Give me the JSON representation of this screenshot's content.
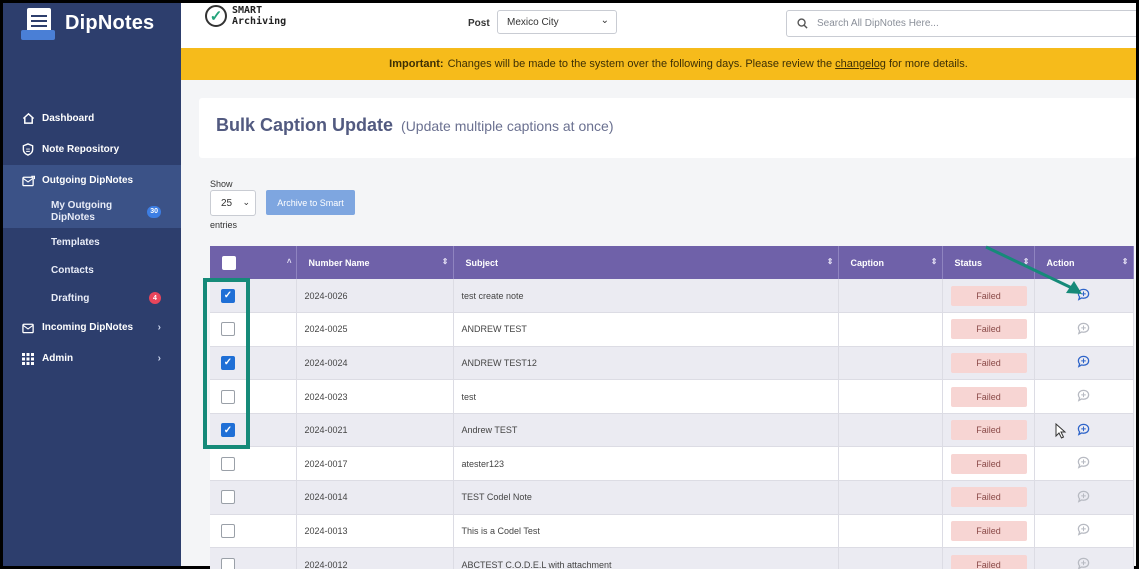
{
  "sidebar": {
    "brand": "DipNotes",
    "items": [
      {
        "label": "Dashboard",
        "icon": "home-icon"
      },
      {
        "label": "Note Repository",
        "icon": "shield-icon"
      },
      {
        "label": "Outgoing DipNotes",
        "icon": "outbox-icon"
      },
      {
        "label": "Incoming DipNotes",
        "icon": "inbox-icon"
      },
      {
        "label": "Admin",
        "icon": "grid-icon"
      }
    ],
    "subitems": [
      {
        "label": "My Outgoing DipNotes",
        "badge": "30"
      },
      {
        "label": "Templates"
      },
      {
        "label": "Contacts"
      },
      {
        "label": "Drafting",
        "badge": "4"
      }
    ]
  },
  "topbar": {
    "smart_line1": "SMART",
    "smart_line2": "Archiving",
    "post_label": "Post",
    "post_value": "Mexico City",
    "search_placeholder": "Search All DipNotes Here..."
  },
  "banner": {
    "strong": "Important:",
    "text": "Changes will be made to the system over the following days. Please review the",
    "link": "changelog",
    "suffix": "for more details."
  },
  "page": {
    "title": "Bulk Caption Update",
    "subtitle": "(Update multiple captions at once)"
  },
  "controls": {
    "show_label": "Show",
    "page_size": "25",
    "entries_label": "entries",
    "archive_button": "Archive to Smart"
  },
  "table": {
    "columns": [
      "Number Name",
      "Subject",
      "Caption",
      "Status",
      "Action"
    ],
    "rows": [
      {
        "checked": true,
        "number": "2024-0026",
        "subject": "test create note",
        "caption": "",
        "status": "Failed",
        "action_active": true
      },
      {
        "checked": false,
        "number": "2024-0025",
        "subject": "ANDREW TEST",
        "caption": "",
        "status": "Failed",
        "action_active": false
      },
      {
        "checked": true,
        "number": "2024-0024",
        "subject": "ANDREW TEST12",
        "caption": "",
        "status": "Failed",
        "action_active": true
      },
      {
        "checked": false,
        "number": "2024-0023",
        "subject": "test",
        "caption": "",
        "status": "Failed",
        "action_active": false
      },
      {
        "checked": true,
        "number": "2024-0021",
        "subject": "Andrew TEST",
        "caption": "",
        "status": "Failed",
        "action_active": true
      },
      {
        "checked": false,
        "number": "2024-0017",
        "subject": "atester123",
        "caption": "",
        "status": "Failed",
        "action_active": false
      },
      {
        "checked": false,
        "number": "2024-0014",
        "subject": "TEST Codel Note",
        "caption": "",
        "status": "Failed",
        "action_active": false
      },
      {
        "checked": false,
        "number": "2024-0013",
        "subject": "This is a Codel Test",
        "caption": "",
        "status": "Failed",
        "action_active": false
      },
      {
        "checked": false,
        "number": "2024-0012",
        "subject": "ABCTEST C.O.D.E.L with attachment",
        "caption": "",
        "status": "Failed",
        "action_active": false
      }
    ]
  },
  "colors": {
    "sidebar": "#2d3e6d",
    "table_header": "#6f61a9",
    "banner": "#f6bb1b",
    "checkbox_on": "#1f6fd6",
    "annotation": "#168a79",
    "status_failed_bg": "#f7d5d3"
  }
}
